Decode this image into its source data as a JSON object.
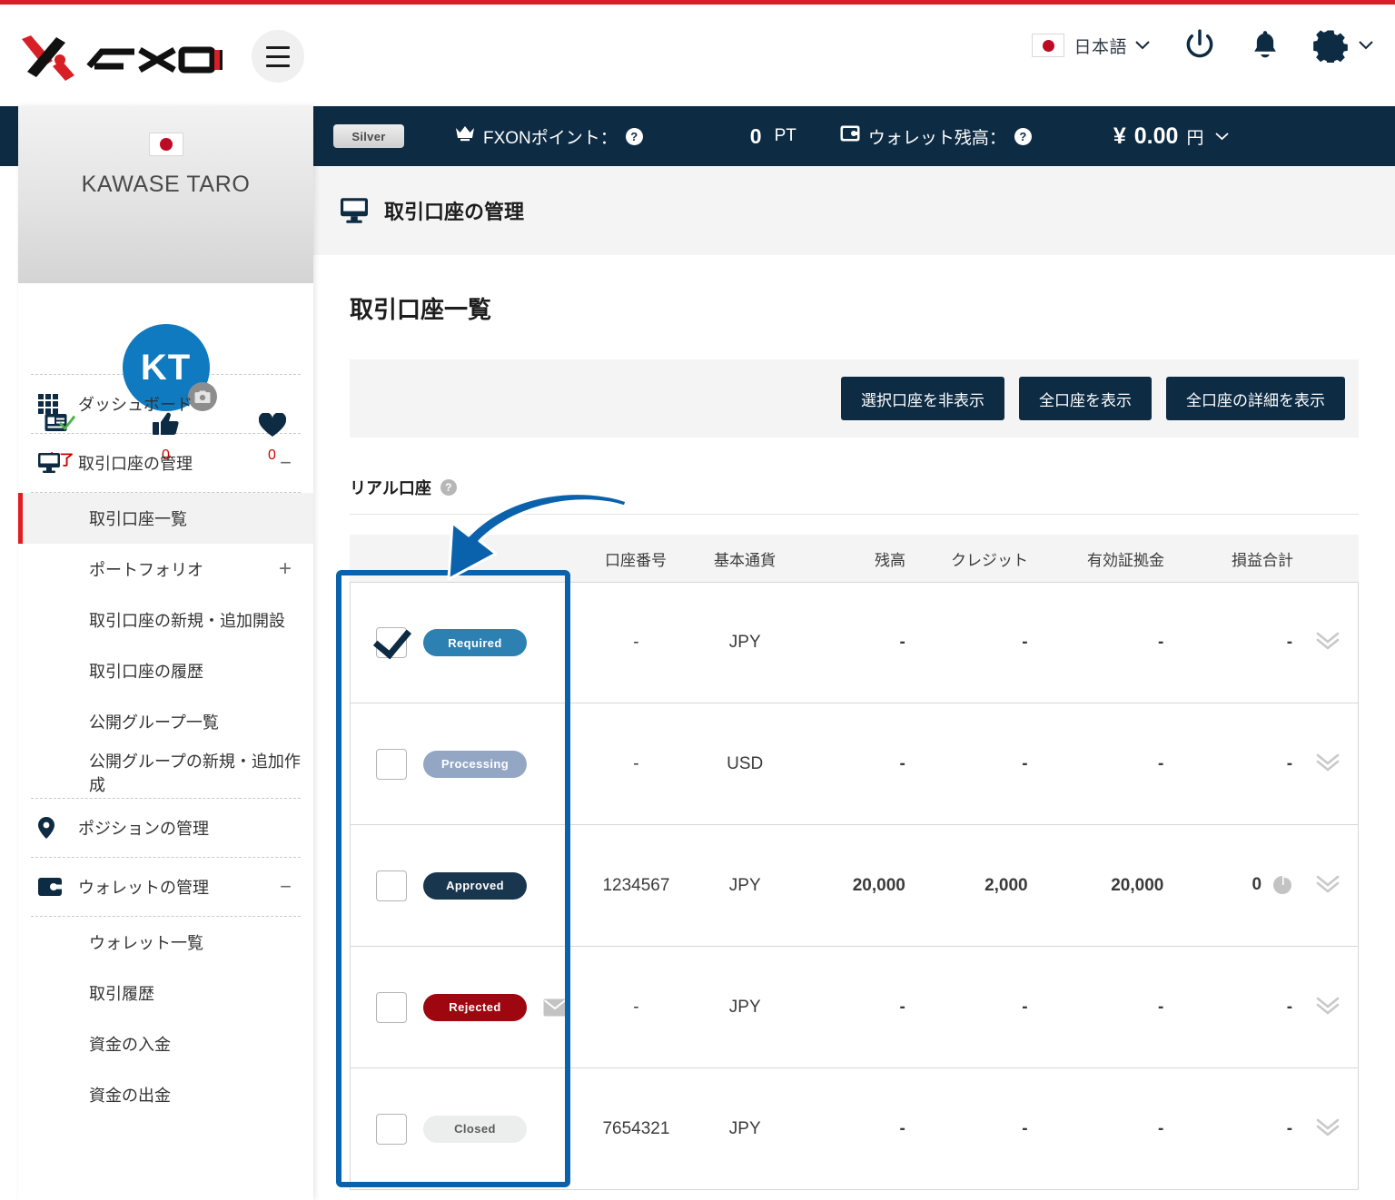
{
  "header": {
    "logo_text": "FXON",
    "menu_icon": "hamburger-icon",
    "language": "日本語",
    "power_icon": "power-icon",
    "bell_icon": "bell-icon",
    "gear_icon": "gear-icon"
  },
  "status_strip": {
    "tier": "Silver",
    "points_label": "FXONポイント：",
    "points_value": "0",
    "points_unit": "PT",
    "wallet_label": "ウォレット残高：",
    "wallet_symbol": "¥",
    "wallet_value": "0.00",
    "wallet_unit": "円"
  },
  "sidebar": {
    "user_name": "KAWASE TARO",
    "avatar_initials": "KT",
    "stats": [
      {
        "icon": "id-verified-icon",
        "label": "完了"
      },
      {
        "icon": "thumbs-up-icon",
        "label": "0"
      },
      {
        "icon": "heart-icon",
        "label": "0"
      }
    ],
    "items": [
      {
        "label": "ダッシュボード",
        "icon": "grid-icon",
        "expander": ""
      },
      {
        "label": "取引口座の管理",
        "icon": "monitor-icon",
        "expander": "−"
      },
      {
        "label": "ポジションの管理",
        "icon": "pin-icon",
        "expander": ""
      },
      {
        "label": "ウォレットの管理",
        "icon": "wallet-icon",
        "expander": "−"
      }
    ],
    "trading_subitems": [
      {
        "label": "取引口座一覧",
        "expander": "",
        "active": true
      },
      {
        "label": "ポートフォリオ",
        "expander": "+",
        "active": false
      },
      {
        "label": "取引口座の新規・追加開設",
        "expander": "",
        "active": false
      },
      {
        "label": "取引口座の履歴",
        "expander": "",
        "active": false
      },
      {
        "label": "公開グループ一覧",
        "expander": "",
        "active": false
      },
      {
        "label": "公開グループの新規・追加作成",
        "expander": "",
        "active": false
      }
    ],
    "wallet_subitems": [
      {
        "label": "ウォレット一覧"
      },
      {
        "label": "取引履歴"
      },
      {
        "label": "資金の入金"
      },
      {
        "label": "資金の出金"
      }
    ]
  },
  "page": {
    "breadcrumb_icon": "monitor-icon",
    "breadcrumb_title": "取引口座の管理",
    "card_title": "取引口座一覧",
    "buttons": [
      {
        "label": "選択口座を非表示"
      },
      {
        "label": "全口座を表示"
      },
      {
        "label": "全口座の詳細を表示"
      }
    ],
    "section_label": "リアル口座",
    "section_help_icon": "help-icon"
  },
  "table": {
    "columns": [
      "",
      "口座番号",
      "基本通貨",
      "残高",
      "クレジット",
      "有効証拠金",
      "損益合計",
      ""
    ],
    "rows": [
      {
        "checked": true,
        "status": "Required",
        "status_key": "required",
        "mail_icon": false,
        "account_no": "-",
        "currency": "JPY",
        "balance": "-",
        "credit": "-",
        "margin": "-",
        "pl": "-",
        "pie_icon": false,
        "expand_icon": "double-chevron-down-icon"
      },
      {
        "checked": false,
        "status": "Processing",
        "status_key": "processing",
        "mail_icon": false,
        "account_no": "-",
        "currency": "USD",
        "balance": "-",
        "credit": "-",
        "margin": "-",
        "pl": "-",
        "pie_icon": false,
        "expand_icon": "double-chevron-down-icon"
      },
      {
        "checked": false,
        "status": "Approved",
        "status_key": "approved",
        "mail_icon": false,
        "account_no": "1234567",
        "currency": "JPY",
        "balance": "20,000",
        "credit": "2,000",
        "margin": "20,000",
        "pl": "0",
        "pie_icon": true,
        "expand_icon": "double-chevron-down-icon"
      },
      {
        "checked": false,
        "status": "Rejected",
        "status_key": "rejected",
        "mail_icon": true,
        "account_no": "-",
        "currency": "JPY",
        "balance": "-",
        "credit": "-",
        "margin": "-",
        "pl": "-",
        "pie_icon": false,
        "expand_icon": "double-chevron-down-icon"
      },
      {
        "checked": false,
        "status": "Closed",
        "status_key": "closed",
        "mail_icon": false,
        "account_no": "7654321",
        "currency": "JPY",
        "balance": "-",
        "credit": "-",
        "margin": "-",
        "pl": "-",
        "pie_icon": false,
        "expand_icon": "double-chevron-down-icon"
      }
    ]
  },
  "annotation": {
    "highlight_color": "#0b62ac",
    "arrow_icon": "curved-arrow-icon"
  },
  "colors": {
    "accent_red": "#d81f26",
    "navy": "#0d2b43",
    "avatar_blue": "#0f7ac0"
  }
}
